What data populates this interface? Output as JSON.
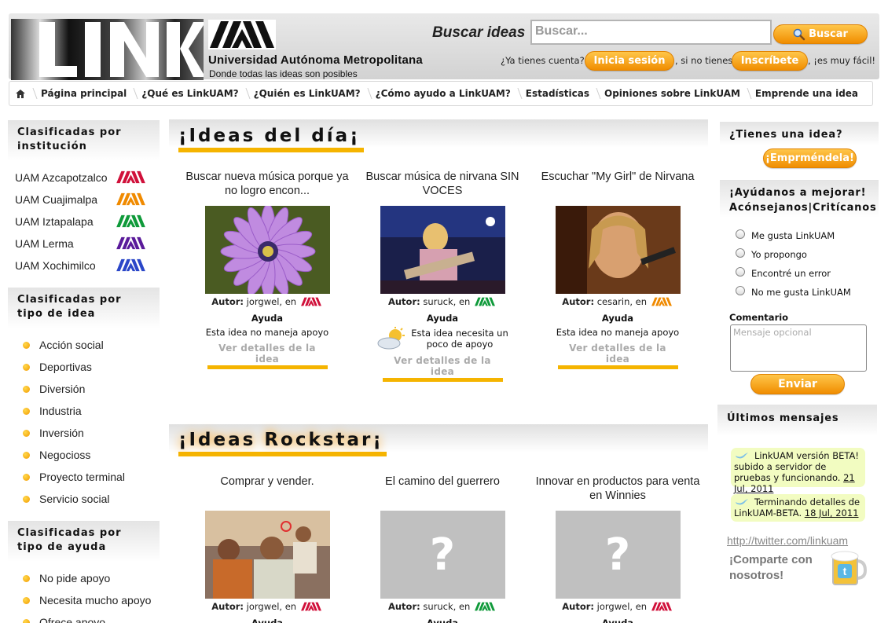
{
  "header": {
    "logo_text": "LINK",
    "university_name": "Universidad Autónoma Metropolitana",
    "slogan": "Donde todas las ideas son posibles",
    "search_label": "Buscar ideas",
    "search_placeholder": "Buscar...",
    "search_button": "Buscar",
    "have_account": "¿Ya tienes cuenta?",
    "login_button": "Inicia sesión",
    "if_not": ", si no tienes",
    "signup_button": "Inscríbete",
    "easy": ", ¡es muy fácil!"
  },
  "nav": {
    "home_icon": "home-icon",
    "items": [
      "Página principal",
      "¿Qué es LinkUAM?",
      "¿Quién es LinkUAM?",
      "¿Cómo ayudo a LinkUAM?",
      "Estadísticas",
      "Opiniones sobre LinkUAM",
      "Emprende una idea"
    ]
  },
  "left": {
    "institution": {
      "title": "Clasificadas por institución",
      "items": [
        {
          "label": "UAM Azcapotzalco",
          "color": "#d0103a"
        },
        {
          "label": "UAM Cuajimalpa",
          "color": "#f08a00"
        },
        {
          "label": "UAM Iztapalapa",
          "color": "#0f9a3a"
        },
        {
          "label": "UAM Lerma",
          "color": "#5a1a9a"
        },
        {
          "label": "UAM Xochimilco",
          "color": "#2a46c8"
        }
      ]
    },
    "idea_type": {
      "title": "Clasificadas por tipo de idea",
      "items": [
        "Acción social",
        "Deportivas",
        "Diversión",
        "Industria",
        "Inversión",
        "Negocioss",
        "Proyecto terminal",
        "Servicio social"
      ]
    },
    "help_type": {
      "title": "Clasificadas por tipo de ayuda",
      "items": [
        "No pide apoyo",
        "Necesita mucho apoyo",
        "Ofrece apoyo"
      ]
    }
  },
  "center": {
    "ideas_day": {
      "title": "¡Ideas del día¡",
      "ideas": [
        {
          "title": "Buscar nueva música porque ya no logro encon...",
          "author_label": "Autor:",
          "author": "jorgwel, en",
          "help": "Ayuda",
          "support": "Esta idea no maneja apoyo",
          "link": "Ver detalles de la idea",
          "image": "purple-flower",
          "inst_color": "#d0103a"
        },
        {
          "title": "Buscar música de nirvana SIN VOCES",
          "author_label": "Autor:",
          "author": "suruck, en",
          "help": "Ayuda",
          "support": "Esta idea necesita un poco de apoyo",
          "link": "Ver detalles de la idea",
          "image": "concert",
          "inst_color": "#0f9a3a"
        },
        {
          "title": "Escuchar \"My Girl\" de Nirvana",
          "author_label": "Autor:",
          "author": "cesarin, en",
          "help": "Ayuda",
          "support": "Esta idea no maneja apoyo",
          "link": "Ver detalles de la idea",
          "image": "singer",
          "inst_color": "#f08a00"
        }
      ]
    },
    "ideas_rockstar": {
      "title": "¡Ideas Rockstar¡",
      "ideas": [
        {
          "title": "Comprar y vender.",
          "author_label": "Autor:",
          "author": "jorgwel, en",
          "help": "Ayuda",
          "image": "people-photo",
          "inst_color": "#d0103a"
        },
        {
          "title": "El camino del guerrero",
          "author_label": "Autor:",
          "author": "suruck, en",
          "help": "Ayuda",
          "image": "placeholder",
          "inst_color": "#0f9a3a"
        },
        {
          "title": "Innovar en productos para venta en Winnies",
          "author_label": "Autor:",
          "author": "jorgwel, en",
          "help": "Ayuda",
          "image": "placeholder",
          "inst_color": "#d0103a"
        }
      ]
    }
  },
  "right": {
    "have_idea_title": "¿Tienes una idea?",
    "emprende_button": "¡Emprméndela!",
    "improve_title_1": "¡Ayúdanos a mejorar!",
    "improve_title_2": "Acónsejanos|Critícanos",
    "options": [
      "Me gusta LinkUAM",
      "Yo propongo",
      "Encontré un error",
      "No me gusta LinkUAM"
    ],
    "comment_label": "Comentario",
    "comment_placeholder": "Mensaje opcional",
    "send_button": "Enviar",
    "messages_title": "Últimos mensajes",
    "tweets": [
      {
        "text": "LinkUAM versión BETA! subido a servidor de pruebas y funcionando.",
        "date": "21 Jul, 2011"
      },
      {
        "text": "Terminando detalles de LinkUAM-BETA.",
        "date": "18 Jul, 2011"
      }
    ],
    "twitter_url": "http://twitter.com/linkuam",
    "share_1": "¡Comparte con",
    "share_2": "nosotros!"
  }
}
